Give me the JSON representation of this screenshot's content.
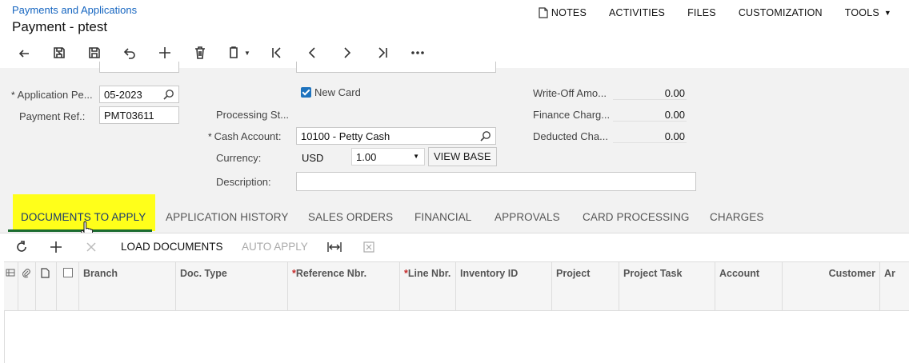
{
  "header": {
    "breadcrumb": "Payments and Applications",
    "title": "Payment - ptest",
    "links": [
      "NOTES",
      "ACTIVITIES",
      "FILES",
      "CUSTOMIZATION",
      "TOOLS"
    ]
  },
  "toolbar": {
    "icons": [
      "back-icon",
      "save-close-icon",
      "save-icon",
      "undo-icon",
      "add-icon",
      "delete-icon",
      "copy-paste-icon",
      "first-icon",
      "previous-icon",
      "next-icon",
      "last-icon",
      "more-icon"
    ]
  },
  "form": {
    "application_period_label": "Application Pe...",
    "application_period_value": "05-2023",
    "payment_ref_label": "Payment Ref.:",
    "payment_ref_value": "PMT03611",
    "new_card_label": "New Card",
    "processing_status_label": "Processing St...",
    "cash_account_label": "Cash Account:",
    "cash_account_value": "10100 - Petty Cash",
    "currency_label": "Currency:",
    "currency_value": "USD",
    "rate_value": "1.00",
    "view_base_label": "VIEW BASE",
    "description_label": "Description:",
    "description_value": "",
    "write_off_label": "Write-Off Amo...",
    "write_off_value": "0.00",
    "finance_charges_label": "Finance Charg...",
    "finance_charges_value": "0.00",
    "deducted_charges_label": "Deducted Cha...",
    "deducted_charges_value": "0.00"
  },
  "tabs": [
    "DOCUMENTS TO APPLY",
    "APPLICATION HISTORY",
    "SALES ORDERS",
    "FINANCIAL",
    "APPROVALS",
    "CARD PROCESSING",
    "CHARGES"
  ],
  "grid_toolbar": {
    "load_documents": "LOAD DOCUMENTS",
    "auto_apply": "AUTO APPLY"
  },
  "grid_columns": {
    "branch": "Branch",
    "doc_type": "Doc. Type",
    "reference_nbr": "Reference Nbr.",
    "line_nbr": "Line Nbr.",
    "inventory_id": "Inventory ID",
    "project": "Project",
    "project_task": "Project Task",
    "account": "Account",
    "customer": "Customer",
    "partial": "Ar"
  },
  "colors": {
    "highlight": "#ffff1a",
    "link_blue": "#1565c0",
    "active_underline": "#1b6b2f",
    "checkbox_blue": "#1e73be",
    "required_star": "#c62828"
  }
}
